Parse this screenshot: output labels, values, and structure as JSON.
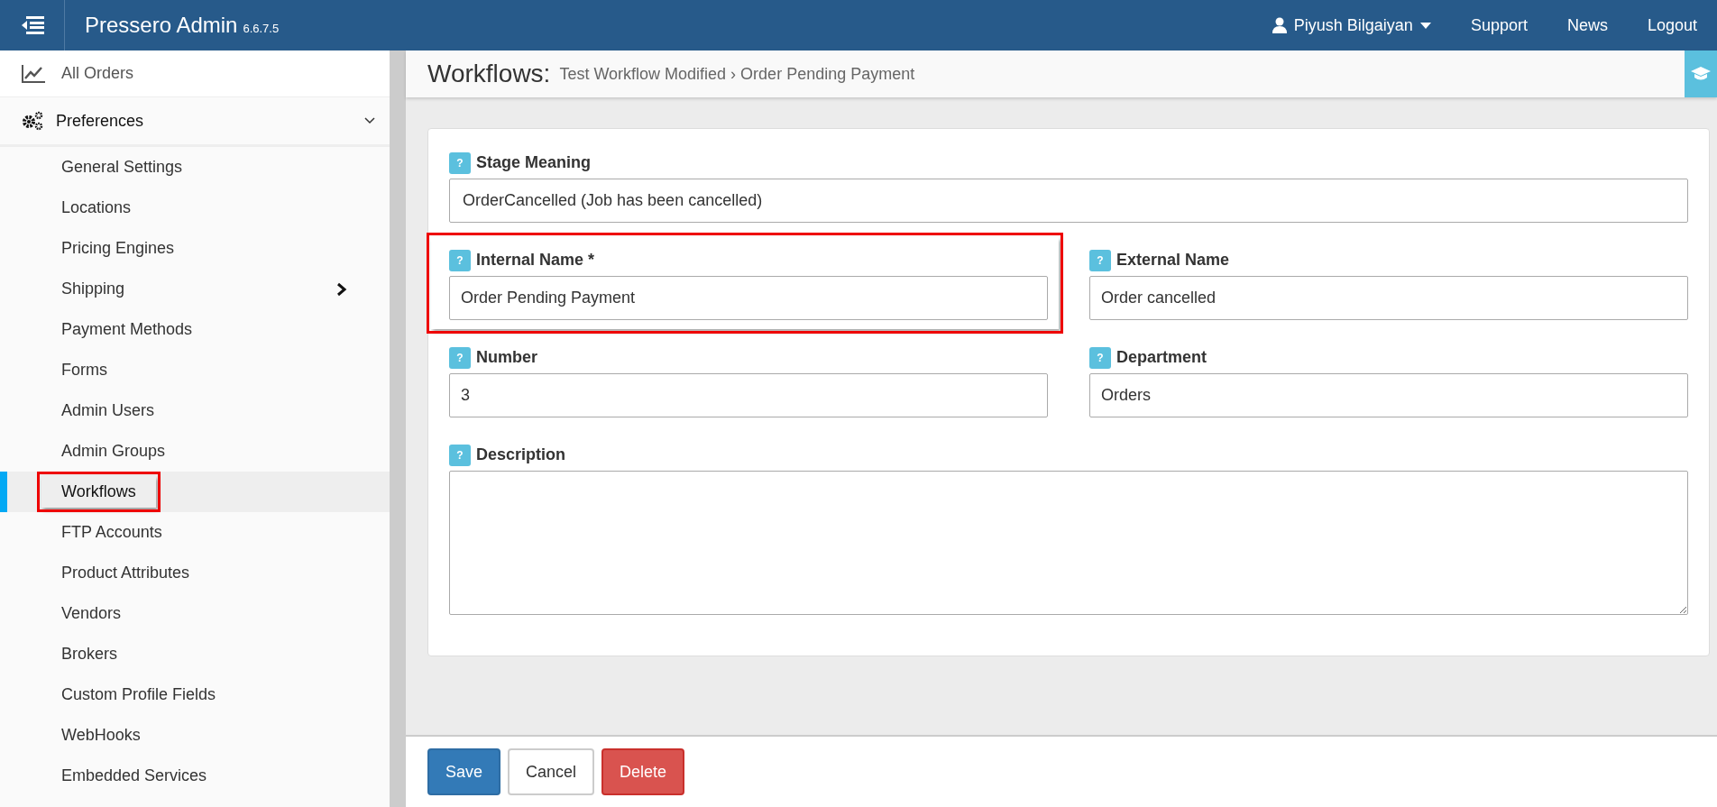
{
  "navbar": {
    "title": "Pressero Admin",
    "version": "6.6.7.5",
    "user": "Piyush Bilgaiyan",
    "links": [
      "Support",
      "News",
      "Logout"
    ]
  },
  "sidebar": {
    "top_item": "All Orders",
    "section": {
      "label": "Preferences",
      "expanded": true
    },
    "items": [
      {
        "label": "General Settings",
        "selected": false,
        "submenu": false,
        "highlighted": false
      },
      {
        "label": "Locations",
        "selected": false,
        "submenu": false,
        "highlighted": false
      },
      {
        "label": "Pricing Engines",
        "selected": false,
        "submenu": false,
        "highlighted": false
      },
      {
        "label": "Shipping",
        "selected": false,
        "submenu": true,
        "highlighted": false
      },
      {
        "label": "Payment Methods",
        "selected": false,
        "submenu": false,
        "highlighted": false
      },
      {
        "label": "Forms",
        "selected": false,
        "submenu": false,
        "highlighted": false
      },
      {
        "label": "Admin Users",
        "selected": false,
        "submenu": false,
        "highlighted": false
      },
      {
        "label": "Admin Groups",
        "selected": false,
        "submenu": false,
        "highlighted": false
      },
      {
        "label": "Workflows",
        "selected": true,
        "submenu": false,
        "highlighted": true
      },
      {
        "label": "FTP Accounts",
        "selected": false,
        "submenu": false,
        "highlighted": false
      },
      {
        "label": "Product Attributes",
        "selected": false,
        "submenu": false,
        "highlighted": false
      },
      {
        "label": "Vendors",
        "selected": false,
        "submenu": false,
        "highlighted": false
      },
      {
        "label": "Brokers",
        "selected": false,
        "submenu": false,
        "highlighted": false
      },
      {
        "label": "Custom Profile Fields",
        "selected": false,
        "submenu": false,
        "highlighted": false
      },
      {
        "label": "WebHooks",
        "selected": false,
        "submenu": false,
        "highlighted": false
      },
      {
        "label": "Embedded Services",
        "selected": false,
        "submenu": false,
        "highlighted": false
      }
    ]
  },
  "header": {
    "title": "Workflows:",
    "breadcrumb": [
      "Test Workflow Modified",
      "Order Pending Payment"
    ],
    "separator": "›"
  },
  "form": {
    "fields": [
      {
        "kind": "select",
        "help": "?",
        "label": "Stage Meaning",
        "value": "OrderCancelled (Job has been cancelled)",
        "highlighted": false
      },
      {
        "kind": "text",
        "help": "?",
        "label": "Internal Name *",
        "value": "Order Pending Payment",
        "highlighted": true
      },
      {
        "kind": "text",
        "help": "?",
        "label": "External Name",
        "value": "Order cancelled",
        "highlighted": false
      },
      {
        "kind": "text",
        "help": "?",
        "label": "Number",
        "value": "3",
        "highlighted": false
      },
      {
        "kind": "text",
        "help": "?",
        "label": "Department",
        "value": "Orders",
        "highlighted": false
      },
      {
        "kind": "textarea",
        "help": "?",
        "label": "Description",
        "highlighted": false
      }
    ]
  },
  "buttons": [
    {
      "label": "Save",
      "kind": "primary"
    },
    {
      "label": "Cancel",
      "kind": "default"
    },
    {
      "label": "Delete",
      "kind": "danger"
    }
  ]
}
